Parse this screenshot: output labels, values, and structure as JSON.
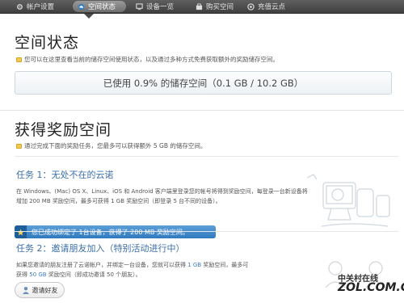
{
  "nav": {
    "tabs": [
      {
        "label": "帐户设置",
        "icon": "gear-icon"
      },
      {
        "label": "空间状态",
        "icon": "cloud-icon",
        "active": true
      },
      {
        "label": "设备一览",
        "icon": "device-icon"
      },
      {
        "label": "购买空间",
        "icon": "cart-icon"
      },
      {
        "label": "充值云点",
        "icon": "coin-icon"
      }
    ]
  },
  "space_status": {
    "title": "空间状态",
    "description": "您可以在这里查看当前的储存空间使用状态，以及通过多种方式免费获取额外的奖励储存空间。",
    "usage_text": "已使用 0.9% 的储存空间（0.1 GB / 10.2 GB）",
    "usage_percent": 0.9
  },
  "rewards": {
    "title": "获得奖励空间",
    "description": "通过完成下面的奖励任务，您最多可以获得额外 5 GB 的储存空间。",
    "task1": {
      "title": "任务 1：无处不在的云诺",
      "text_line1": "在 Windows、(Mac) OS X、Linux、iOS 和 Android 客户端里登录您的帐号将得到奖励空间，每登录一台新设备将",
      "text_line2": "增加 200 MB 奖励空间，最多可获得 1 GB 奖励空间（即登录 5 台不同的设备）。",
      "success_text": "您已成功绑定了 1台设备，获得了 200 MB 奖励空间。"
    },
    "task2": {
      "title": "任务 2：邀请朋友加入（特别活动进行中）",
      "text_line1_a": "如果您邀请的朋友注册了云诺帐户，并绑定一台设备，您就可以获得 ",
      "text_line1_hl": "1 GB",
      "text_line1_b": " 奖励空间，最多可",
      "text_line2_a": "获得 ",
      "text_line2_hl": "50 GB",
      "text_line2_b": " 奖励空间（即成功邀请 50 个朋友）。",
      "button_label": "邀请好友"
    }
  },
  "watermark": {
    "small": "中关村在线",
    "big": "ZOL.COM.CN"
  },
  "colors": {
    "accent": "#3b6fa8",
    "success_bar": "#2f79bf",
    "nav_bg": "#4b4b4b"
  }
}
